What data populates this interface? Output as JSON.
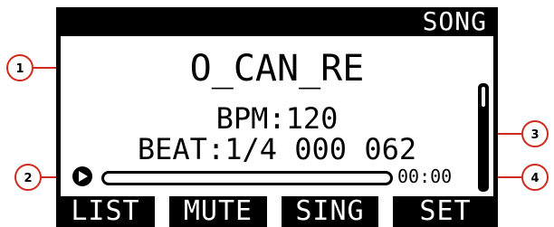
{
  "header": {
    "title": "SONG"
  },
  "song": {
    "name": "O_CAN_RE",
    "bpm_text": "BPM:120",
    "beat_text": "BEAT:1/4 000 062"
  },
  "playback": {
    "progress": 0.0,
    "time": "00:00"
  },
  "volume_meter": {
    "level": 0.8
  },
  "softkeys": [
    "LIST",
    "MUTE",
    "SING",
    "SET"
  ],
  "callouts": [
    "1",
    "2",
    "3",
    "4"
  ],
  "colors": {
    "screen_bg": "#ffffff",
    "ink": "#000000",
    "callout": "#d02a1e"
  }
}
